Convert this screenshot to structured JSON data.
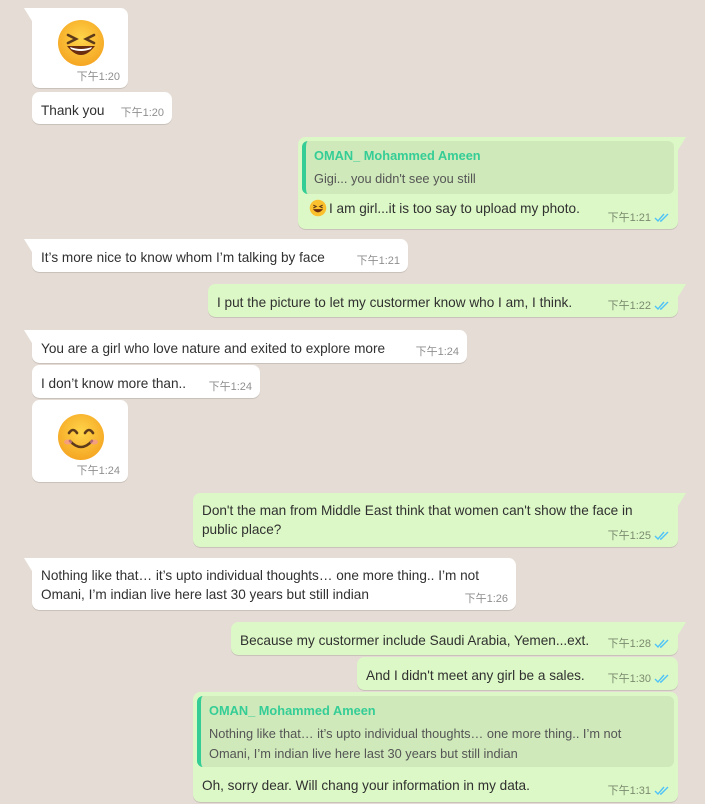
{
  "messages": [
    {
      "id": "m1",
      "emoji": "laughing-face",
      "time": "下午1:20"
    },
    {
      "id": "m2",
      "text": "Thank you",
      "time": "下午1:20"
    },
    {
      "id": "m3",
      "quote": {
        "author": "OMAN_ Mohammed Ameen",
        "text": "Gigi... you didn't see you still"
      },
      "emoji": "laughing-face",
      "text": "I am girl...it is too say to upload my photo.",
      "time": "下午1:21"
    },
    {
      "id": "m4",
      "text": "It’s more nice to know whom I’m talking by face",
      "time": "下午1:21"
    },
    {
      "id": "m5",
      "text": "I put the picture to let my custormer know who I am, I think.",
      "time": "下午1:22"
    },
    {
      "id": "m6",
      "text": "You are a girl who love nature and exited to explore more",
      "time": "下午1:24"
    },
    {
      "id": "m7",
      "text": "I don’t know more than..",
      "time": "下午1:24"
    },
    {
      "id": "m8",
      "emoji": "smiling-face",
      "time": "下午1:24"
    },
    {
      "id": "m9",
      "text_lines": [
        "Don't the man from Middle East think that women can't show the face in",
        "public place?"
      ],
      "time": "下午1:25"
    },
    {
      "id": "m10",
      "text_lines": [
        "Nothing like that… it’s upto individual thoughts… one more thing.. I’m not",
        "Omani, I’m indian live here last 30 years but still indian"
      ],
      "time": "下午1:26"
    },
    {
      "id": "m11",
      "text": "Because my custormer include Saudi Arabia, Yemen...ext.",
      "time": "下午1:28"
    },
    {
      "id": "m12",
      "text": "And I didn't meet any girl be a sales.",
      "time": "下午1:30"
    },
    {
      "id": "m13",
      "quote": {
        "author": "OMAN_ Mohammed Ameen",
        "text_lines": [
          "Nothing like that… it’s upto individual thoughts… one more thing.. I’m not",
          "Omani, I’m indian live here last 30 years but still indian"
        ]
      },
      "text": "Oh, sorry dear. Will chang your information in my data.",
      "time": "下午1:31"
    }
  ],
  "colors": {
    "background": "#e5ddd5",
    "incoming_bubble": "#ffffff",
    "outgoing_bubble": "#dcf8c6",
    "quote_accent": "#35cd96",
    "read_ticks": "#4fc3f7"
  }
}
